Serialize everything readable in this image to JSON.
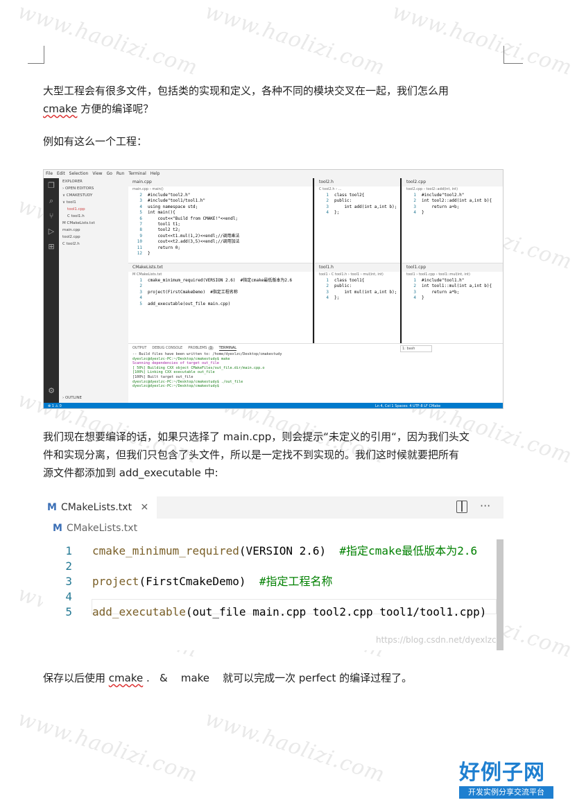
{
  "paragraphs": {
    "p1_line1": "大型工程会有很多文件，包括类的实现和定义，各种不同的模块交叉在一起，我们怎么用",
    "p1_line2_word": "cmake",
    "p1_line2_rest": " 方便的编译呢？",
    "p2": "例如有这么一个工程：",
    "p3_line1": "我们现在想要编译的话，如果只选择了 main.cpp，则会提示“未定义的引用“，因为我们头文",
    "p3_line2": "件和实现分离，但我们只包含了头文件，所以是一定找不到实现的。我们这时候就要把所有",
    "p3_line3": "源文件都添加到 add_executable 中:",
    "p4_pre": "保存以后使用 ",
    "p4_word": "cmake",
    "p4_post": " .   &    make    就可以完成一次 perfect 的编译过程了。"
  },
  "watermark": "www.haolizi.com",
  "logo": {
    "title": "好例子网",
    "subtitle": "开发实例分享交流平台"
  },
  "ide": {
    "menu": [
      "File",
      "Edit",
      "Selection",
      "View",
      "Go",
      "Run",
      "Terminal",
      "Help"
    ],
    "sidebar": [
      "EXPLORER",
      "› OPEN EDITORS",
      "∨ CMAKESTUDY",
      "∨ tool1",
      "tool1.cpp",
      "C tool1.h",
      "M CMakeLists.txt",
      "main.cpp",
      "tool2.cpp",
      "C tool2.h"
    ],
    "outline": "› OUTLINE",
    "main_tab": "main.cpp",
    "main_crumb": "main.cpp › main()",
    "main_code": [
      [
        "2",
        "#include\"tool2.h\""
      ],
      [
        "3",
        "#include\"tool1/tool1.h\""
      ],
      [
        "4",
        "using namespace std;"
      ],
      [
        "5",
        "int main(){"
      ],
      [
        "6",
        "    cout<<\"Build from CMAKE!\"<<endl;"
      ],
      [
        "7",
        "    tool1 t1;"
      ],
      [
        "8",
        "    tool2 t2;"
      ],
      [
        "9",
        "    cout<<t1.mul(1,2)<<endl;//调用乘法"
      ],
      [
        "10",
        "    cout<<t2.add(3,5)<<endl;//调用加法"
      ],
      [
        "11",
        "    return 0;"
      ],
      [
        "12",
        "}"
      ]
    ],
    "tool2h_tab": "tool2.h",
    "tool2h_crumb": "C tool2.h › ...",
    "tool2h_code": [
      [
        "1",
        "class tool2{"
      ],
      [
        "2",
        "public:"
      ],
      [
        "3",
        "    int add(int a,int b);"
      ],
      [
        "4",
        "};"
      ]
    ],
    "tool2cpp_tab": "tool2.cpp",
    "tool2cpp_crumb": "tool2.cpp › tool2::add(int, int)",
    "tool2cpp_code": [
      [
        "1",
        "#include\"tool2.h\""
      ],
      [
        "2",
        "int tool2::add(int a,int b){"
      ],
      [
        "3",
        "    return a+b;"
      ],
      [
        "4",
        "}"
      ]
    ],
    "cmake_tab": "CMakeLists.txt",
    "cmake_crumb": "M CMakeLists.txt",
    "cmake_code": [
      [
        "1",
        "cmake_minimum_required(VERSION 2.6)  #指定cmake最低版本为2.6"
      ],
      [
        "2",
        ""
      ],
      [
        "3",
        "project(FirstCmakeDemo)  #指定工程名称"
      ],
      [
        "4",
        ""
      ],
      [
        "5",
        "add_executable(out_file main.cpp)"
      ]
    ],
    "tool1h_tab": "tool1.h",
    "tool1h_crumb": "tool1 › C tool1.h › tool1 › mul(int, int)",
    "tool1h_code": [
      [
        "1",
        "class tool1{"
      ],
      [
        "2",
        "public:"
      ],
      [
        "3",
        "    int mul(int a,int b);"
      ],
      [
        "4",
        "};"
      ]
    ],
    "tool1cpp_tab": "tool1.cpp",
    "tool1cpp_crumb": "tool1 › tool1.cpp › tool1::mul(int, int)",
    "tool1cpp_code": [
      [
        "1",
        "#include\"tool1.h\""
      ],
      [
        "2",
        "int tool1::mul(int a,int b){"
      ],
      [
        "3",
        "    return a*b;"
      ],
      [
        "4",
        "}"
      ]
    ],
    "terminal_tabs": [
      "OUTPUT",
      "DEBUG CONSOLE",
      "PROBLEMS",
      "TERMINAL"
    ],
    "problems_count": "1",
    "terminal_select": "1: bash",
    "terminal_lines": [
      "-- Build files have been written to: /home/dyexlzc/Desktop/cmakestudy",
      "dyexlzc@dyexlzc-PC:~/Desktop/cmakestudy$ make",
      "Scanning dependencies of target out_file",
      "[ 50%] Building CXX object CMakeFiles/out_file.dir/main.cpp.o",
      "[100%] Linking CXX executable out_file",
      "[100%] Built target out_file",
      "dyexlzc@dyexlzc-PC:~/Desktop/cmakestudy$ ./out_file",
      "dyexlzc@dyexlzc-PC:~/Desktop/cmakestudy$ "
    ],
    "status_left": "⊗ 1 ⚠ 0",
    "status_right": "Ln 4, Col 1   Spaces: 4   UTF-8   LF   CMake"
  },
  "big": {
    "tab": "CMakeLists.txt",
    "tab_mark": "M",
    "crumb": "CMakeLists.txt",
    "crumb_mark": "M",
    "lines": [
      {
        "n": "1",
        "fn": "cmake_minimum_required",
        "args": "(VERSION 2.6)  ",
        "cm": "#指定cmake最低版本为2.6"
      },
      {
        "n": "2",
        "fn": "",
        "args": "",
        "cm": ""
      },
      {
        "n": "3",
        "fn": "project",
        "args": "(FirstCmakeDemo)  ",
        "cm": "#指定工程名称"
      },
      {
        "n": "4",
        "fn": "",
        "args": "",
        "cm": ""
      },
      {
        "n": "5",
        "fn": "add_executable",
        "args": "(out_file main.cpp tool2.cpp tool1/tool1.cpp)",
        "cm": ""
      }
    ],
    "csdn": "https://blog.csdn.net/dyexlzc"
  },
  "colors": {
    "accent": "#007acc",
    "logo_blue": "#1e7fd0"
  }
}
